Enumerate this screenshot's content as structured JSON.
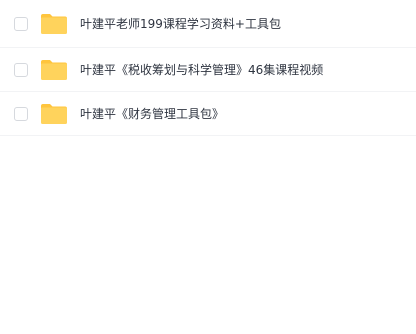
{
  "files": [
    {
      "name": "叶建平老师199课程学习资料+工具包",
      "type": "folder",
      "icon": "folder-icon"
    },
    {
      "name": "叶建平《税收筹划与科学管理》46集课程视频",
      "type": "folder",
      "icon": "folder-icon"
    },
    {
      "name": "叶建平《财务管理工具包》",
      "type": "folder",
      "icon": "folder-icon"
    }
  ],
  "colors": {
    "folder": "#FFD35C",
    "folder_tab": "#FFC53D",
    "text": "#2E3440",
    "divider": "#F2F3F5"
  }
}
